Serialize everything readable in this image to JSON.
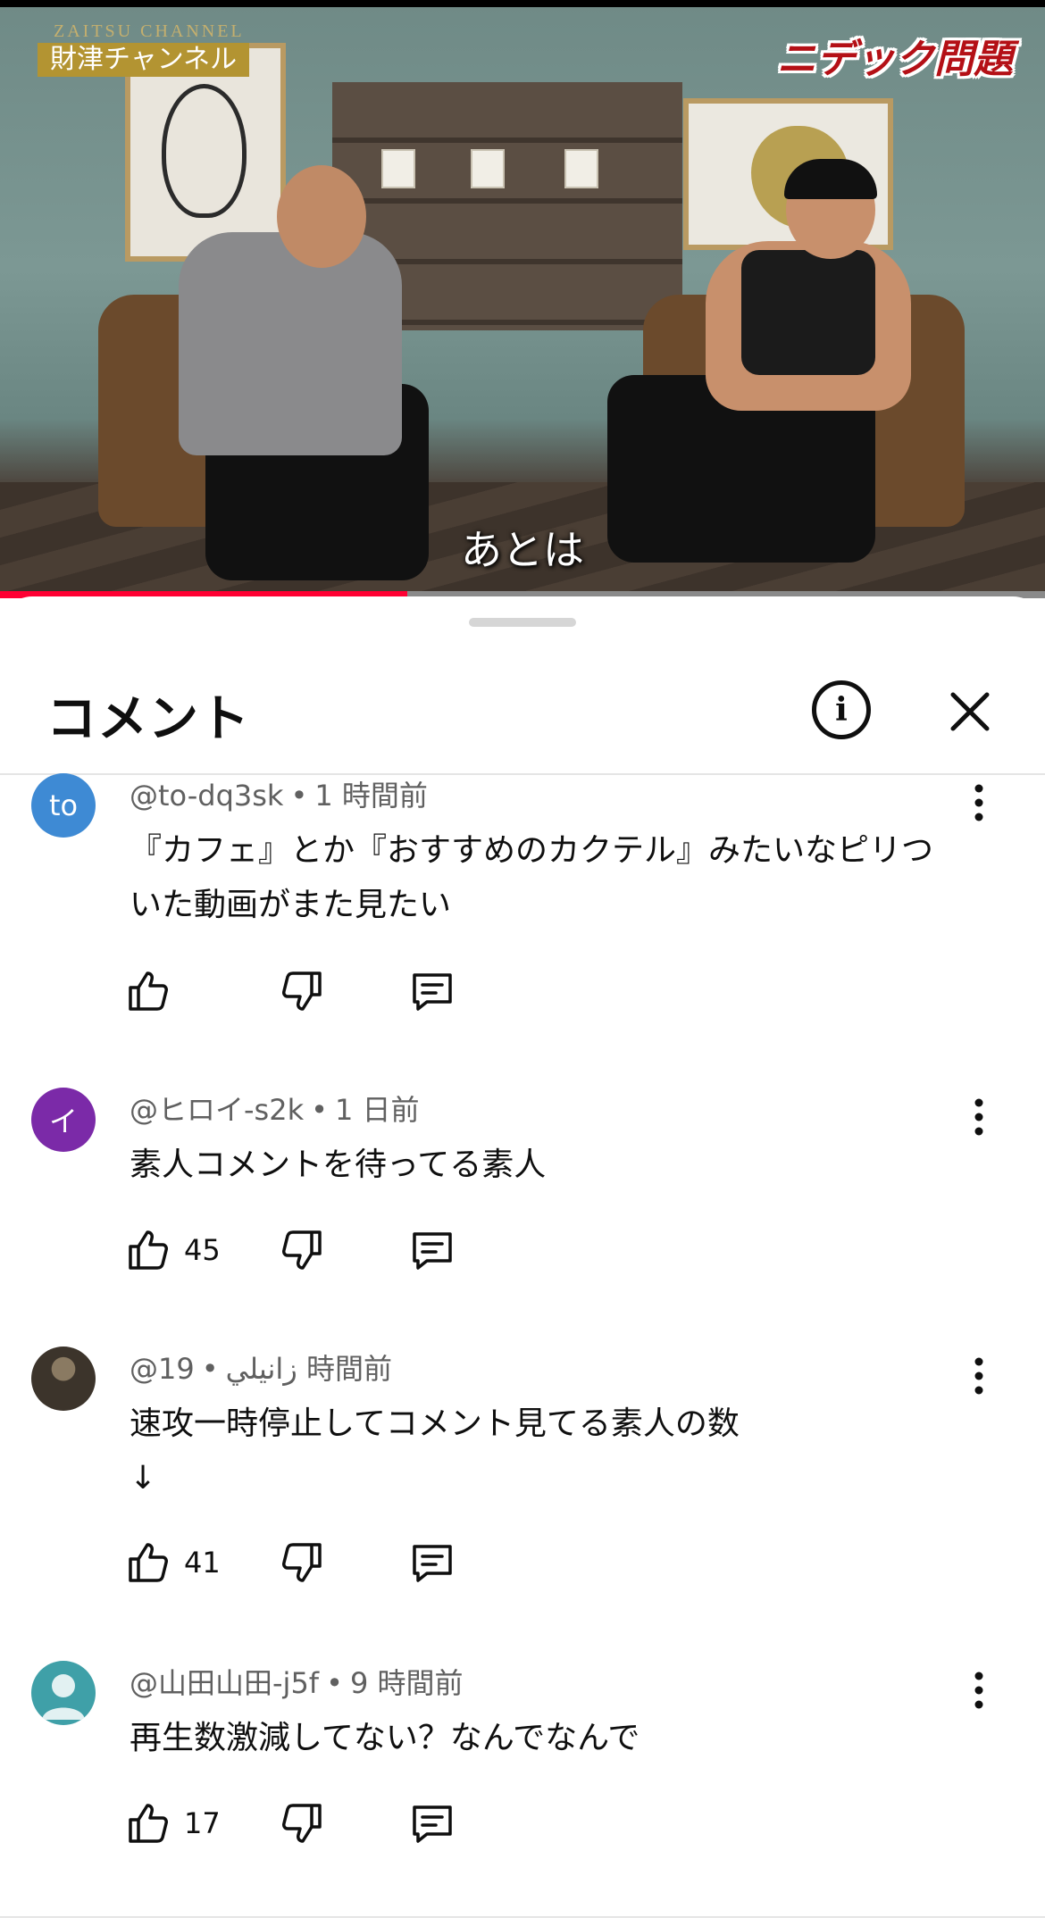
{
  "video": {
    "channel_en": "ZAITSU CHANNEL",
    "channel_name": "財津チャンネル",
    "topic": "ニデック問題",
    "subtitle": "あとは",
    "progress": 0.39,
    "progress_color": "#ff0033"
  },
  "sheet": {
    "title": "コメント",
    "info_icon": "info-icon",
    "close_icon": "close-icon"
  },
  "comments": [
    {
      "avatar_text": "to",
      "avatar_color": "#3e8ad4",
      "author": "@to-dq3sk",
      "time": "1 時間前",
      "text_lines": [
        "『カフェ』とか『おすすめのカクテル』みたいなピリつ",
        "いた動画がまた見たい"
      ],
      "likes": ""
    },
    {
      "avatar_text": "イ",
      "avatar_color": "#7b2aa8",
      "author": "@ヒロイ-s2k",
      "time": "1 日前",
      "text_lines": [
        "素人コメントを待ってる素人"
      ],
      "likes": "45"
    },
    {
      "avatar_text": "",
      "avatar_color": "#4a4238",
      "author": "@زانيلي",
      "time": "19 時間前",
      "text_lines": [
        "速攻一時停止してコメント見てる素人の数",
        "↓"
      ],
      "likes": "41"
    },
    {
      "avatar_text": "",
      "avatar_color": "#3fa0a8",
      "author": "@山田山田-j5f",
      "time": "9 時間前",
      "text_lines": [
        "再生数激減してない？なんでなんで"
      ],
      "likes": "17"
    }
  ]
}
